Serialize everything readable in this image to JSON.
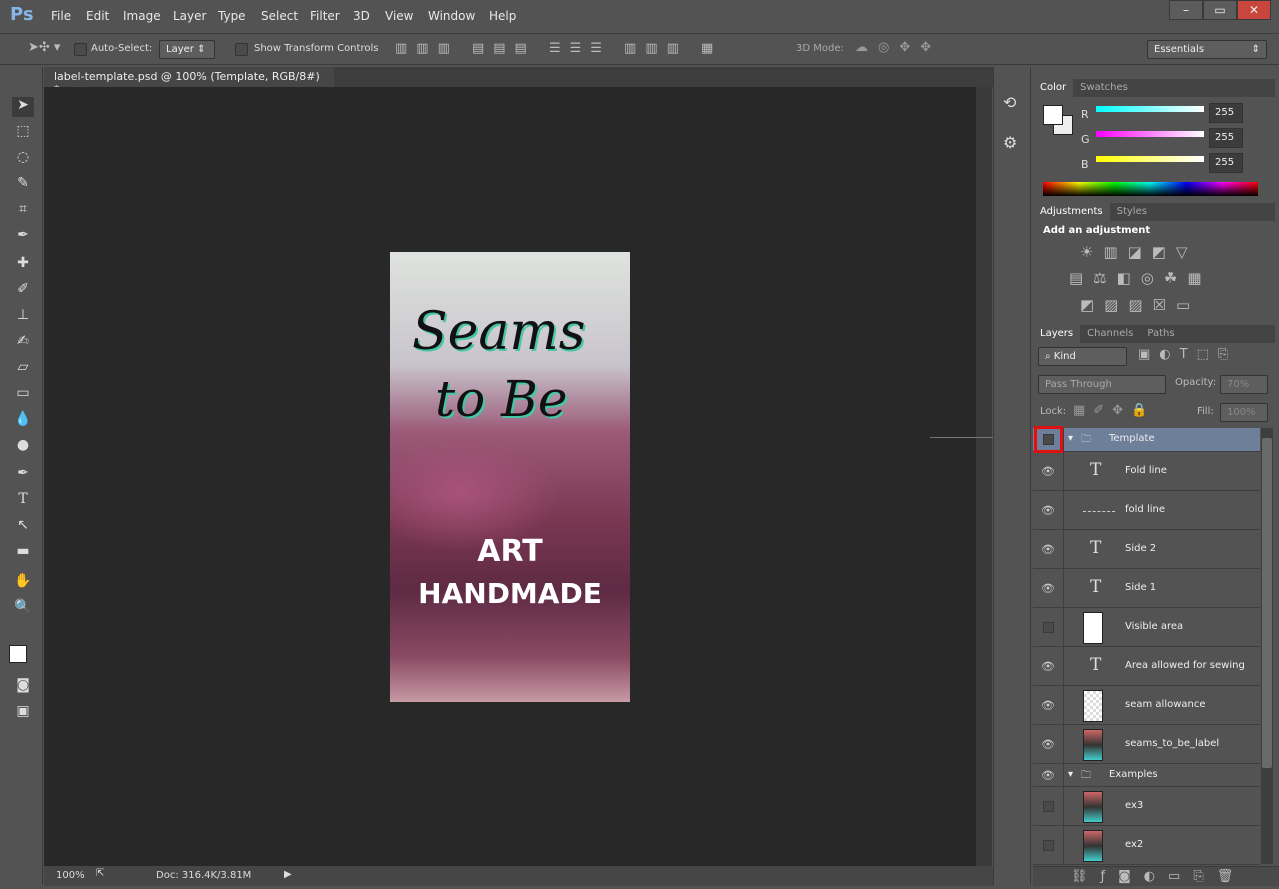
{
  "app": {
    "logo": "Ps",
    "menu": [
      "File",
      "Edit",
      "Image",
      "Layer",
      "Type",
      "Select",
      "Filter",
      "3D",
      "View",
      "Window",
      "Help"
    ],
    "window_controls": [
      "–",
      "▭",
      "✕"
    ]
  },
  "options": {
    "auto_select_label": "Auto-Select:",
    "auto_select_target": "Layer",
    "show_transform_label": "Show Transform Controls",
    "mode_3d_label": "3D Mode:",
    "workspace": "Essentials"
  },
  "document": {
    "tab_title": "label-template.psd @ 100% (Template, RGB/8#) *",
    "close": "×",
    "zoom": "100%",
    "doc_info": "Doc: 316.4K/3.81M",
    "canvas_text": {
      "line1": "Seams",
      "line2": "to Be",
      "line3": "ART",
      "line4": "HANDMADE"
    }
  },
  "color_panel": {
    "tabs": [
      "Color",
      "Swatches"
    ],
    "channels": [
      {
        "label": "R",
        "value": "255"
      },
      {
        "label": "G",
        "value": "255"
      },
      {
        "label": "B",
        "value": "255"
      }
    ]
  },
  "adjustments_panel": {
    "tabs": [
      "Adjustments",
      "Styles"
    ],
    "heading": "Add an adjustment"
  },
  "layers_panel": {
    "tabs": [
      "Layers",
      "Channels",
      "Paths"
    ],
    "filter": "Kind",
    "blend_mode": "Pass Through",
    "opacity_label": "Opacity:",
    "opacity": "70%",
    "lock_label": "Lock:",
    "fill_label": "Fill:",
    "fill": "100%",
    "layers": [
      {
        "name": "Template",
        "type": "group",
        "visible": false,
        "selected": true
      },
      {
        "name": "Fold line",
        "type": "text",
        "visible": true
      },
      {
        "name": "fold line",
        "type": "line",
        "visible": true
      },
      {
        "name": "Side 2",
        "type": "text",
        "visible": true
      },
      {
        "name": "Side 1",
        "type": "text",
        "visible": true
      },
      {
        "name": "Visible area",
        "type": "shape",
        "visible": false
      },
      {
        "name": "Area allowed for sewing",
        "type": "text",
        "visible": true
      },
      {
        "name": "seam allowance",
        "type": "raster",
        "visible": true
      },
      {
        "name": "seams_to_be_label",
        "type": "image",
        "visible": true
      },
      {
        "name": "Examples",
        "type": "group",
        "visible": true
      },
      {
        "name": "ex3",
        "type": "image",
        "visible": false
      },
      {
        "name": "ex2",
        "type": "image",
        "visible": false
      }
    ]
  },
  "colors": {
    "selected_layer": "#6d7f99",
    "highlight": "#e01010",
    "canvas_bg": "#282828"
  }
}
